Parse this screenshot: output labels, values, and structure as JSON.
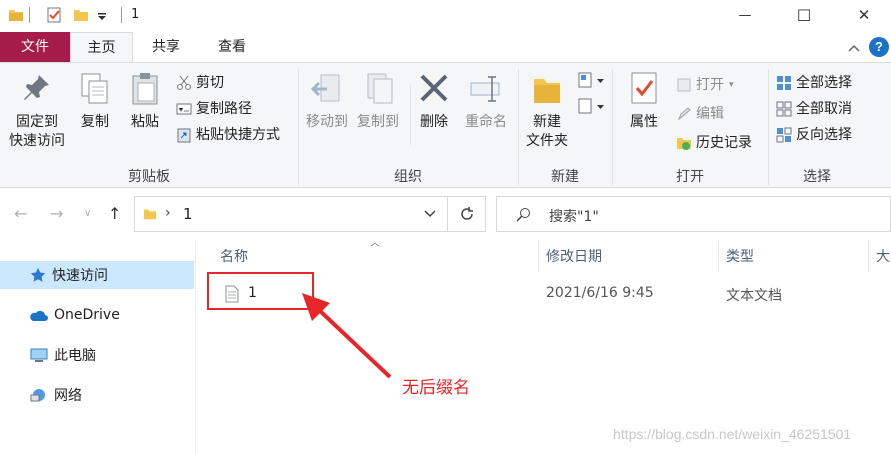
{
  "titlebar": {
    "title": "1",
    "minimize_glyph": "—",
    "maximize_glyph": "☐",
    "close_glyph": "✕"
  },
  "tabs": {
    "file": "文件",
    "home": "主页",
    "share": "共享",
    "view": "查看",
    "help": "?"
  },
  "ribbon": {
    "clipboard": {
      "label": "剪贴板",
      "pin": [
        "固定到",
        "快速访问"
      ],
      "copy": "复制",
      "paste": "粘贴",
      "cut": "剪切",
      "copy_path": "复制路径",
      "paste_shortcut": "粘贴快捷方式"
    },
    "organize": {
      "label": "组织",
      "move_to": "移动到",
      "copy_to": "复制到",
      "delete": "删除",
      "rename": "重命名"
    },
    "new": {
      "label": "新建",
      "new_folder": [
        "新建",
        "文件夹"
      ]
    },
    "open": {
      "label": "打开",
      "properties": "属性",
      "open": "打开",
      "edit": "编辑",
      "history": "历史记录"
    },
    "select": {
      "label": "选择",
      "select_all": "全部选择",
      "select_none": "全部取消",
      "invert": "反向选择"
    }
  },
  "address": {
    "path": "1",
    "search_placeholder": "搜索\"1\""
  },
  "navpane": {
    "items": [
      {
        "label": "快速访问",
        "selected": true
      },
      {
        "label": "OneDrive",
        "selected": false
      },
      {
        "label": "此电脑",
        "selected": false
      },
      {
        "label": "网络",
        "selected": false
      }
    ]
  },
  "filelist": {
    "columns": [
      "名称",
      "修改日期",
      "类型",
      "大"
    ],
    "rows": [
      {
        "name": "1",
        "modified": "2021/6/16 9:45",
        "type": "文本文档"
      }
    ]
  },
  "annotation": {
    "text": "无后缀名",
    "color": "#e8262a"
  },
  "watermark": "https://blog.csdn.net/weixin_46251501",
  "colors": {
    "file_tab": "#a51c4b",
    "selection": "#cce8ff",
    "folder": "#f4c64d",
    "help": "#1a73c8"
  }
}
